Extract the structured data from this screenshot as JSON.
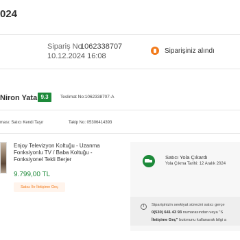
{
  "header": {
    "title": "024"
  },
  "order": {
    "number_label": "Sipariş No",
    "number_value": "1062338707",
    "date": "10.12.2024 16:08",
    "status_text": "Siparişiniz alındı",
    "status_color": "#f27a1a"
  },
  "seller": {
    "name": "Niron Yatak",
    "score": "9.3",
    "score_color": "#1d8a3a",
    "delivery_no": "Teslimat No:1062338707-A",
    "ship_method": "ması: Satıcı Kendi Taşır",
    "tracking_no": "Takip No: 05306414393"
  },
  "product": {
    "title": "Enjoy Televizyon Koltuğu - Uzanma Fonksiyonlu TV / Baba Koltuğu - Fonksiyonel Tekli Berjer",
    "price": "9.799,00 TL",
    "price_color": "#1f8a3a",
    "contact_button_label": "Satıcı İle İletişime Geç"
  },
  "shipment": {
    "title": "Satıcı Yola Çıkardı",
    "date": "Yola Çıkma Tarihi: 12 Aralık 2024"
  },
  "notice": {
    "line1": "Siparişinizin sevkiyat sürecini satıcı gerçe",
    "line2_bold": "0(530) 641 43 93",
    "line2_text": " numarasından veya \"S",
    "line3_bold": "İletişime Geç\"",
    "line3_text": " butonunu kullanarak bilgi a"
  }
}
